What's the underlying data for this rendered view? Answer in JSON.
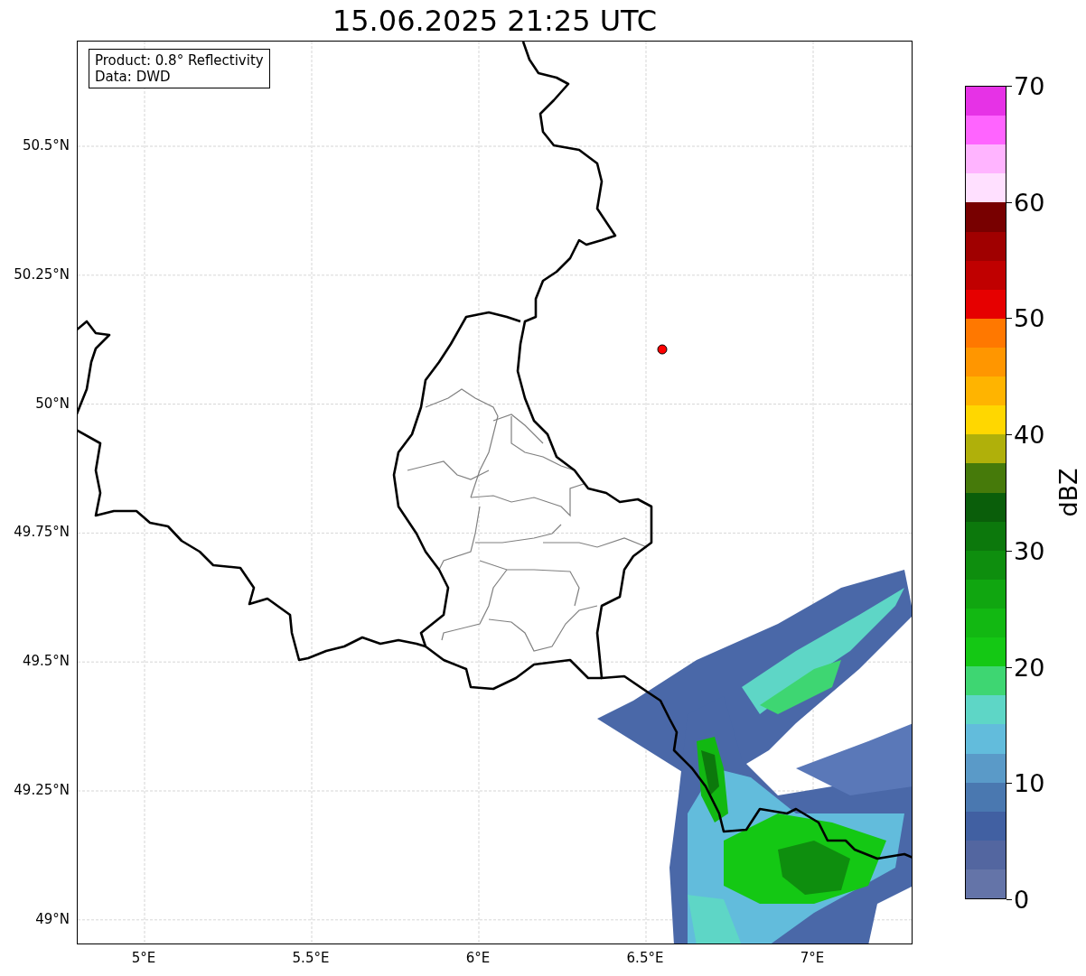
{
  "map": {
    "title": "15.06.2025 21:25 UTC",
    "latitude_labels": [
      "50.5°N",
      "50.25°N",
      "50°N",
      "49.75°N",
      "49.5°N",
      "49.25°N",
      "49°N"
    ],
    "longitude_labels": [
      "5°E",
      "5.5°E",
      "6°E",
      "6.5°E",
      "7°E"
    ],
    "info_lines": [
      "Product: 0.8° Reflectivity",
      "Data: DWD"
    ]
  },
  "colorbar": {
    "label": "dBZ",
    "tick_labels": [
      "70",
      "60",
      "50",
      "40",
      "30",
      "20",
      "10",
      "0"
    ],
    "segments": [
      {
        "color": "#e632e6"
      },
      {
        "color": "#ff64ff"
      },
      {
        "color": "#ffb4ff"
      },
      {
        "color": "#ffe0ff"
      },
      {
        "color": "#780000"
      },
      {
        "color": "#a00000"
      },
      {
        "color": "#c00000"
      },
      {
        "color": "#e60000"
      },
      {
        "color": "#ff7800"
      },
      {
        "color": "#ff9600"
      },
      {
        "color": "#ffb400"
      },
      {
        "color": "#ffd700"
      },
      {
        "color": "#b0b00a"
      },
      {
        "color": "#467a0a"
      },
      {
        "color": "#0a5e0a"
      },
      {
        "color": "#0c780c"
      },
      {
        "color": "#0e8e0e"
      },
      {
        "color": "#10a610"
      },
      {
        "color": "#12b812"
      },
      {
        "color": "#14c814"
      },
      {
        "color": "#3ed672"
      },
      {
        "color": "#5ed6c6"
      },
      {
        "color": "#62bcdc"
      },
      {
        "color": "#5a9ac8"
      },
      {
        "color": "#4a78b0"
      },
      {
        "color": "#4160a2"
      },
      {
        "color": "#5366a0"
      },
      {
        "color": "#6474a8"
      }
    ]
  }
}
